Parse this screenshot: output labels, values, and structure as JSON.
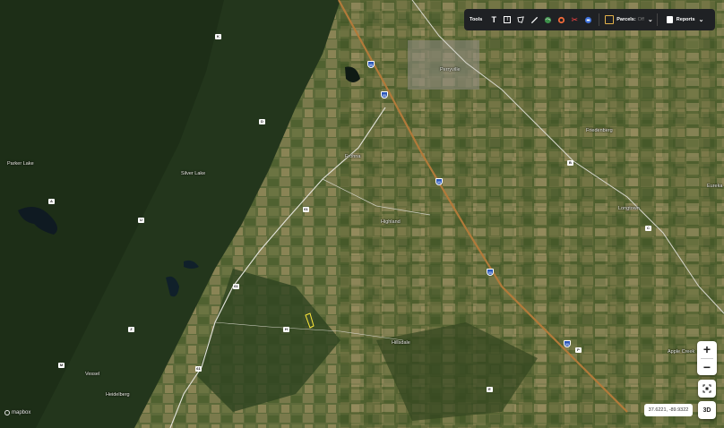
{
  "toolbar": {
    "tools_label": "Tools",
    "parcels_label": "Parcels:",
    "parcels_value": "Off",
    "reports_label": "Reports",
    "icons": [
      "text-t-icon",
      "text-box-icon",
      "polygon-draw-icon",
      "ruler-icon",
      "globe-icon",
      "circle-icon",
      "scissors-icon",
      "layers-icon"
    ]
  },
  "map": {
    "places": {
      "perryville": "Perryville",
      "frohna": "Frohna",
      "highland": "Highland",
      "longtown": "Longtown",
      "eureka": "Eureka",
      "frieden": "Friedenberg",
      "silver_lake": "Silver Lake",
      "parker": "Parker Lake",
      "hillsdale": "Hillsdale",
      "vandis": "Vessel",
      "heidelberg": "Heidelberg",
      "appleton": "Apple Creek"
    },
    "routes": {
      "i55_a": "55",
      "i55_b": "55",
      "i55_c": "55",
      "i55_d": "55",
      "i55_e": "55",
      "r61_a": "61",
      "r61_b": "61",
      "r61_c": "61",
      "k": "K",
      "d": "D",
      "u": "U",
      "a": "A",
      "b": "B",
      "c": "C",
      "z": "Z",
      "m": "M",
      "h": "H",
      "e": "E",
      "p": "P"
    }
  },
  "controls": {
    "zoom_in": "+",
    "zoom_out": "−",
    "coordinates": "37.6221, -89.9322",
    "view3d": "3D",
    "logo": "mapbox"
  }
}
